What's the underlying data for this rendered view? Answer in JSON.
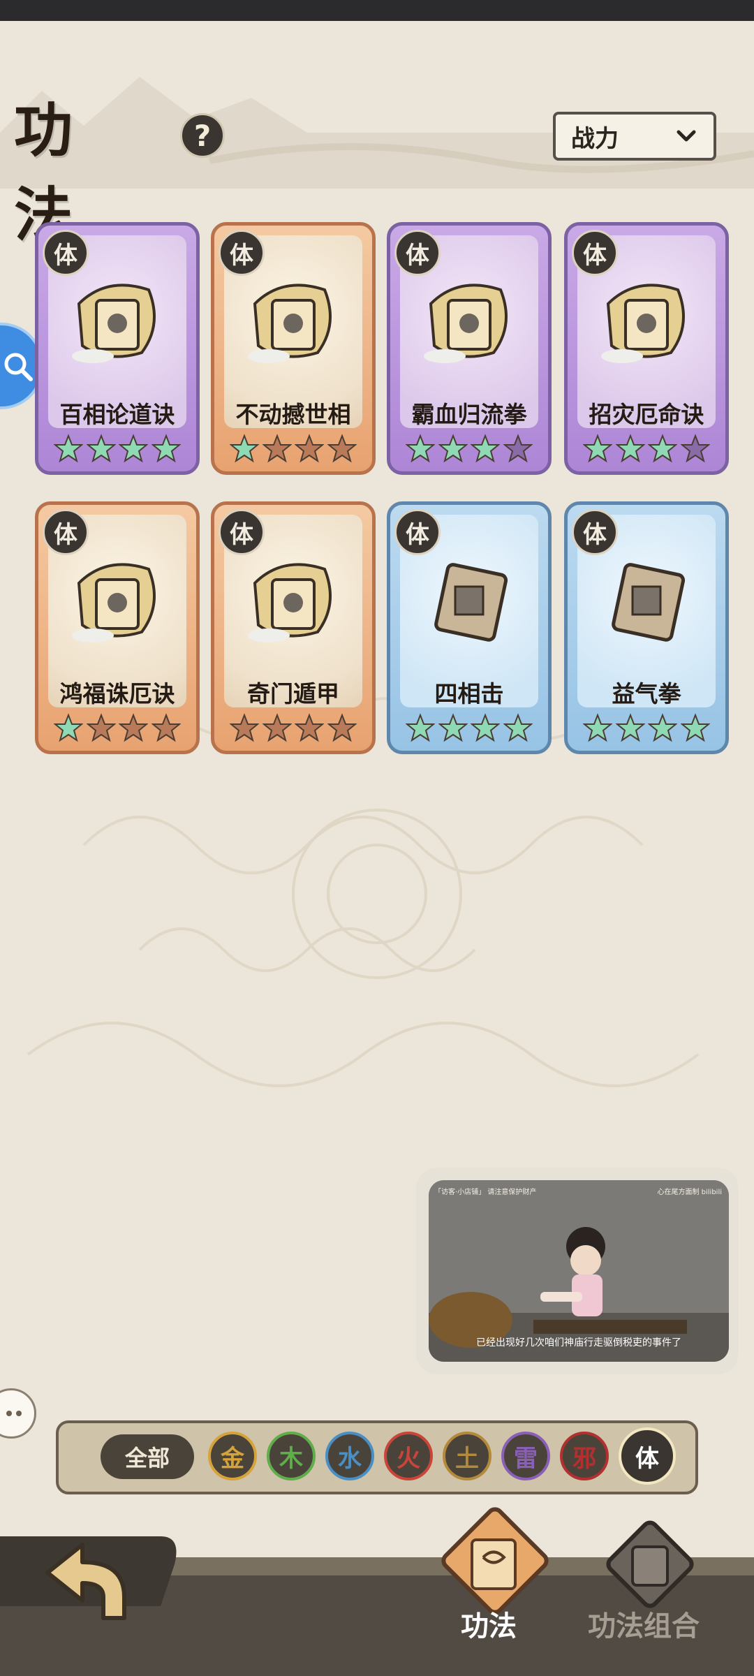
{
  "header": {
    "title": "功法",
    "help_icon": "?"
  },
  "sort": {
    "selected": "战力"
  },
  "cards": [
    {
      "name": "百相论道诀",
      "badge": "体",
      "rarity": "purple",
      "stars_filled": 4,
      "stars_total": 4
    },
    {
      "name": "不动撼世相",
      "badge": "体",
      "rarity": "orange",
      "stars_filled": 1,
      "stars_total": 4
    },
    {
      "name": "霸血归流拳",
      "badge": "体",
      "rarity": "purple",
      "stars_filled": 3,
      "stars_total": 4
    },
    {
      "name": "招灾厄命诀",
      "badge": "体",
      "rarity": "purple",
      "stars_filled": 3,
      "stars_total": 4
    },
    {
      "name": "鸿福诛厄诀",
      "badge": "体",
      "rarity": "orange",
      "stars_filled": 1,
      "stars_total": 4
    },
    {
      "name": "奇门遁甲",
      "badge": "体",
      "rarity": "orange",
      "stars_filled": 0,
      "stars_total": 4
    },
    {
      "name": "四相击",
      "badge": "体",
      "rarity": "blue",
      "stars_filled": 4,
      "stars_total": 4
    },
    {
      "name": "益气拳",
      "badge": "体",
      "rarity": "blue",
      "stars_filled": 4,
      "stars_total": 4
    }
  ],
  "filters": {
    "all_label": "全部",
    "elements": [
      {
        "label": "金",
        "color": "#d6a33a"
      },
      {
        "label": "木",
        "color": "#5fae4a"
      },
      {
        "label": "水",
        "color": "#4a8fc4"
      },
      {
        "label": "火",
        "color": "#c9453a"
      },
      {
        "label": "土",
        "color": "#b38a3c"
      },
      {
        "label": "雷",
        "color": "#8a5fb6"
      },
      {
        "label": "邪",
        "color": "#b33030"
      },
      {
        "label": "体",
        "color": "#3a3530"
      }
    ],
    "selected": "体"
  },
  "video": {
    "top_left": "「访客·小店铺」 请注意保护财产",
    "top_right": "心在尾方面制 bilibili",
    "subtitle": "已经出现好几次咱们神庙行走驱倒税吏的事件了"
  },
  "bottom_nav": {
    "tabs": [
      {
        "label": "功法",
        "active": true
      },
      {
        "label": "功法组合",
        "active": false
      }
    ]
  },
  "colors": {
    "star_filled": "#8fd9b5",
    "star_empty_orange": "#b97a5a",
    "star_empty_purple": "#8b6aa8"
  }
}
